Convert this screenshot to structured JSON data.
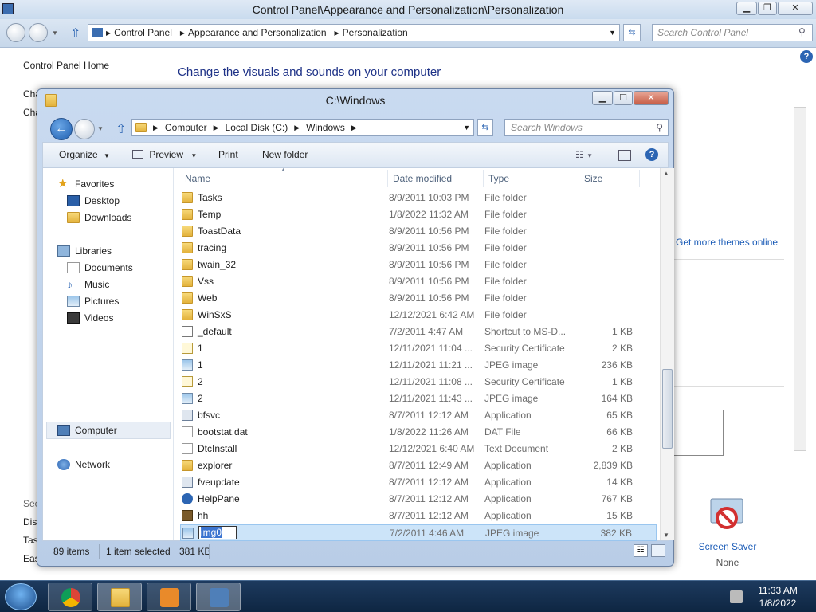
{
  "background_window": {
    "title": "Control Panel\\Appearance and Personalization\\Personalization",
    "breadcrumbs": [
      "Control Panel",
      "Appearance and Personalization",
      "Personalization"
    ],
    "search_placeholder": "Search Control Panel",
    "left_pane": {
      "home_link": "Control Panel Home",
      "fragments": [
        "Cha",
        "Cha",
        "See",
        "Disp",
        "Tas",
        "Eas"
      ]
    },
    "heading": "Change the visuals and sounds on your computer",
    "themes_link": "Get more themes online",
    "screen_saver": {
      "label": "Screen Saver",
      "value": "None"
    }
  },
  "explorer": {
    "title": "C:\\Windows",
    "address": [
      "Computer",
      "Local Disk (C:)",
      "Windows"
    ],
    "search_placeholder": "Search Windows",
    "toolbar": {
      "organize": "Organize",
      "preview": "Preview",
      "print": "Print",
      "new_folder": "New folder"
    },
    "nav": {
      "favorites": "Favorites",
      "favorites_items": [
        "Desktop",
        "Downloads"
      ],
      "libraries": "Libraries",
      "libraries_items": [
        "Documents",
        "Music",
        "Pictures",
        "Videos"
      ],
      "computer": "Computer",
      "network": "Network"
    },
    "columns": {
      "name": "Name",
      "date": "Date modified",
      "type": "Type",
      "size": "Size"
    },
    "files": [
      {
        "name": "Tasks",
        "date": "8/9/2011 10:03 PM",
        "type": "File folder",
        "size": "",
        "icon": "folder-icon"
      },
      {
        "name": "Temp",
        "date": "1/8/2022 11:32 AM",
        "type": "File folder",
        "size": "",
        "icon": "folder-icon"
      },
      {
        "name": "ToastData",
        "date": "8/9/2011 10:56 PM",
        "type": "File folder",
        "size": "",
        "icon": "folder-icon"
      },
      {
        "name": "tracing",
        "date": "8/9/2011 10:56 PM",
        "type": "File folder",
        "size": "",
        "icon": "folder-icon"
      },
      {
        "name": "twain_32",
        "date": "8/9/2011 10:56 PM",
        "type": "File folder",
        "size": "",
        "icon": "folder-icon"
      },
      {
        "name": "Vss",
        "date": "8/9/2011 10:56 PM",
        "type": "File folder",
        "size": "",
        "icon": "folder-icon"
      },
      {
        "name": "Web",
        "date": "8/9/2011 10:56 PM",
        "type": "File folder",
        "size": "",
        "icon": "folder-icon"
      },
      {
        "name": "WinSxS",
        "date": "12/12/2021 6:42 AM",
        "type": "File folder",
        "size": "",
        "icon": "folder-icon"
      },
      {
        "name": "_default",
        "date": "7/2/2011 4:47 AM",
        "type": "Shortcut to MS-D...",
        "size": "1 KB",
        "icon": "shortcut-icon"
      },
      {
        "name": "1",
        "date": "12/11/2021 11:04 ...",
        "type": "Security Certificate",
        "size": "2 KB",
        "icon": "certificate-icon"
      },
      {
        "name": "1",
        "date": "12/11/2021 11:21 ...",
        "type": "JPEG image",
        "size": "236 KB",
        "icon": "image-icon"
      },
      {
        "name": "2",
        "date": "12/11/2021 11:08 ...",
        "type": "Security Certificate",
        "size": "1 KB",
        "icon": "certificate-icon"
      },
      {
        "name": "2",
        "date": "12/11/2021 11:43 ...",
        "type": "JPEG image",
        "size": "164 KB",
        "icon": "image-icon"
      },
      {
        "name": "bfsvc",
        "date": "8/7/2011 12:12 AM",
        "type": "Application",
        "size": "65 KB",
        "icon": "application-icon"
      },
      {
        "name": "bootstat.dat",
        "date": "1/8/2022 11:26 AM",
        "type": "DAT File",
        "size": "66 KB",
        "icon": "file-icon"
      },
      {
        "name": "DtcInstall",
        "date": "12/12/2021 6:40 AM",
        "type": "Text Document",
        "size": "2 KB",
        "icon": "text-document-icon"
      },
      {
        "name": "explorer",
        "date": "8/7/2011 12:49 AM",
        "type": "Application",
        "size": "2,839 KB",
        "icon": "explorer-icon"
      },
      {
        "name": "fveupdate",
        "date": "8/7/2011 12:12 AM",
        "type": "Application",
        "size": "14 KB",
        "icon": "application-icon"
      },
      {
        "name": "HelpPane",
        "date": "8/7/2011 12:12 AM",
        "type": "Application",
        "size": "767 KB",
        "icon": "help-icon"
      },
      {
        "name": "hh",
        "date": "8/7/2011 12:12 AM",
        "type": "Application",
        "size": "15 KB",
        "icon": "hh-icon"
      },
      {
        "name": "img0",
        "date": "7/2/2011 4:46 AM",
        "type": "JPEG image",
        "size": "382 KB",
        "icon": "image-icon",
        "selected": true
      }
    ],
    "status": {
      "item_count": "89 items",
      "selection": "1 item selected",
      "selection_size": "381 KB"
    }
  },
  "taskbar": {
    "time": "11:33 AM",
    "date": "1/8/2022"
  }
}
